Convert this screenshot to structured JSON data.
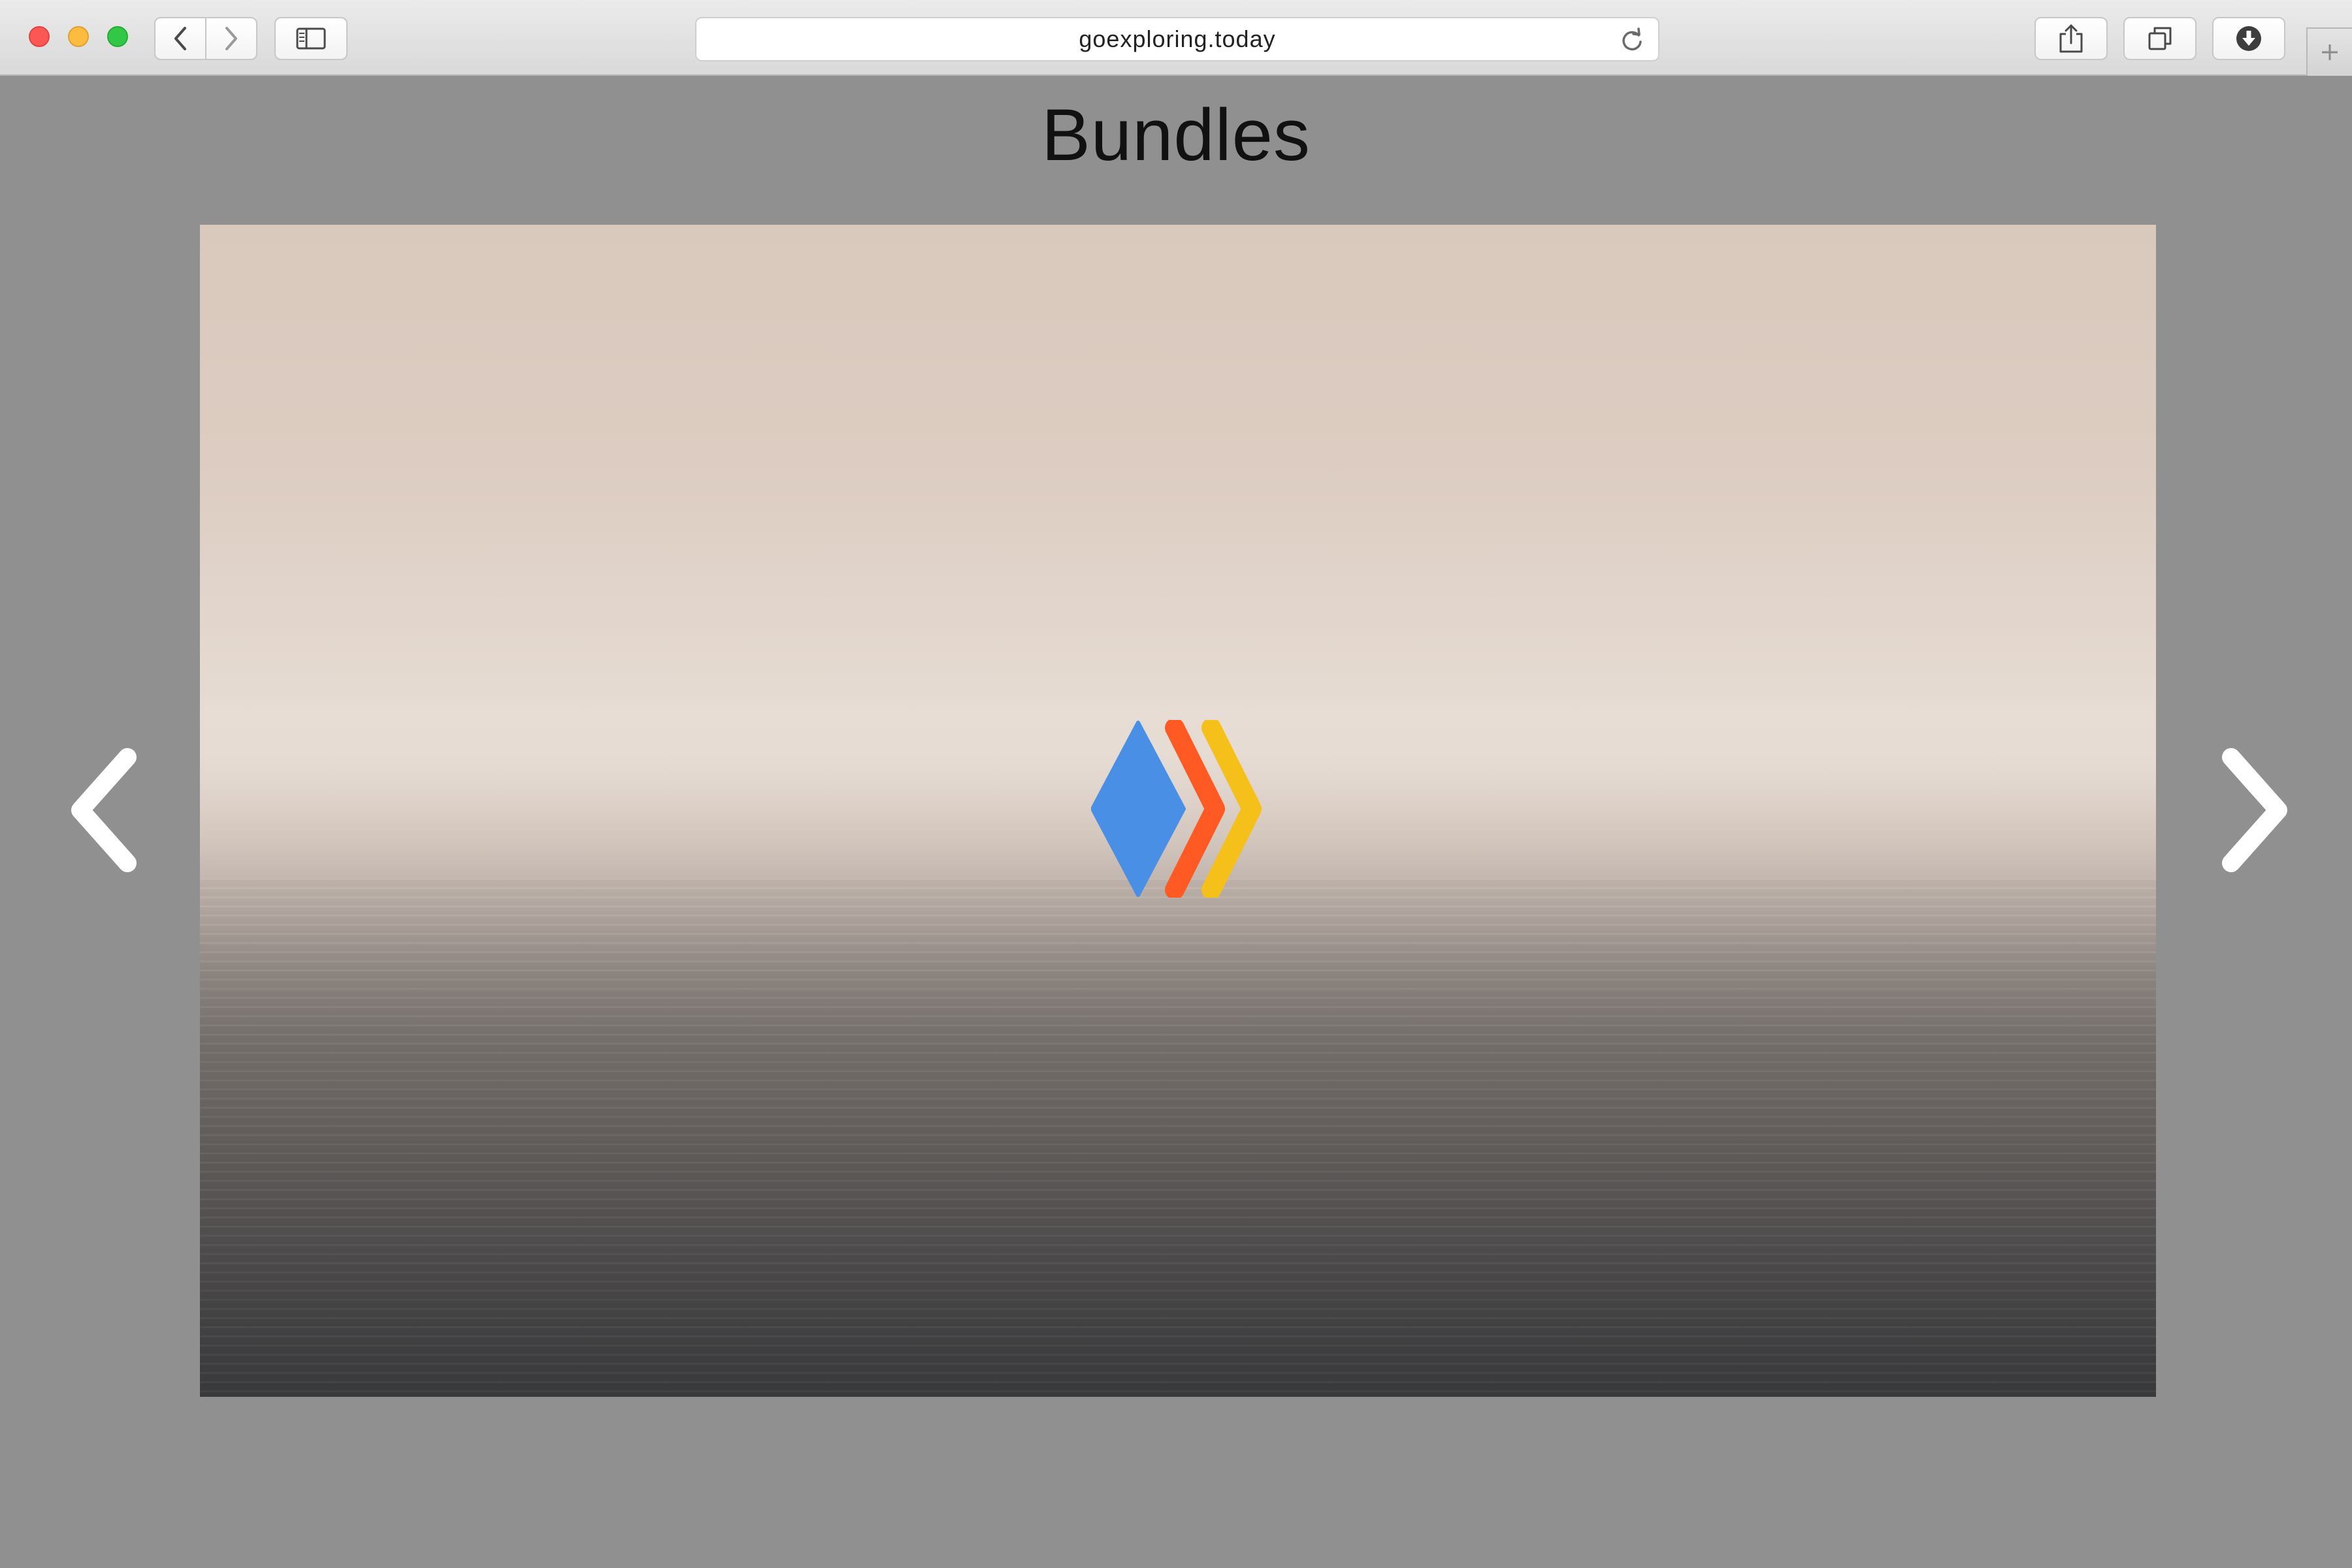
{
  "browser": {
    "url": "goexploring.today",
    "icons": {
      "back": "chevron-left-icon",
      "forward": "chevron-right-icon",
      "sidebar": "sidebar-icon",
      "reload": "reload-icon",
      "share": "share-icon",
      "tabs": "tabs-overview-icon",
      "download": "download-icon",
      "new_tab": "plus-icon"
    }
  },
  "page": {
    "title": "Bundles",
    "slider": {
      "prev_icon": "chevron-left-icon",
      "next_icon": "chevron-right-icon"
    },
    "logo_colors": {
      "diamond": "#4a8fe6",
      "chevron_1": "#ff5a24",
      "chevron_2": "#f5c01a"
    }
  },
  "colors": {
    "page_background": "#909090",
    "toolbar": "#e0e0e0"
  }
}
